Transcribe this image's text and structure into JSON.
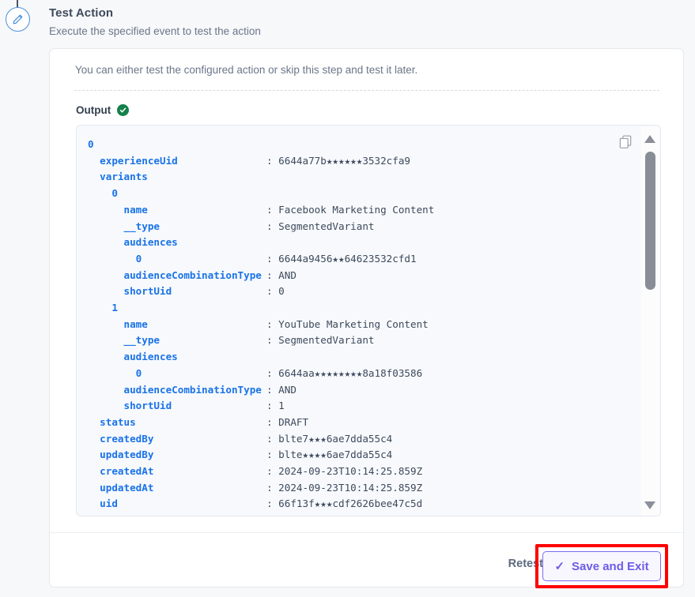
{
  "header": {
    "title": "Test Action",
    "subtitle": "Execute the specified event to test the action",
    "step_icon": "pencil-icon"
  },
  "card": {
    "intro": "You can either test the configured action or skip this step and test it later.",
    "output_label": "Output",
    "output_status_icon": "green-check-circle-icon",
    "copy_icon": "copy-icon"
  },
  "json_output": {
    "rows": [
      {
        "indent": 0,
        "key": "0",
        "colon": "",
        "value": ""
      },
      {
        "indent": 1,
        "key": "experienceUid",
        "colon": ":",
        "value": "6644a77b★★★★★★3532cfa9"
      },
      {
        "indent": 1,
        "key": "variants",
        "colon": "",
        "value": ""
      },
      {
        "indent": 2,
        "key": "0",
        "colon": "",
        "value": ""
      },
      {
        "indent": 3,
        "key": "name",
        "colon": ":",
        "value": "Facebook Marketing Content"
      },
      {
        "indent": 3,
        "key": "__type",
        "colon": ":",
        "value": "SegmentedVariant"
      },
      {
        "indent": 3,
        "key": "audiences",
        "colon": "",
        "value": ""
      },
      {
        "indent": 4,
        "key": "0",
        "colon": ":",
        "value": "6644a9456★★64623532cfd1"
      },
      {
        "indent": 3,
        "key": "audienceCombinationType",
        "colon": ":",
        "value": "AND"
      },
      {
        "indent": 3,
        "key": "shortUid",
        "colon": ":",
        "value": "0"
      },
      {
        "indent": 2,
        "key": "1",
        "colon": "",
        "value": ""
      },
      {
        "indent": 3,
        "key": "name",
        "colon": ":",
        "value": "YouTube Marketing Content"
      },
      {
        "indent": 3,
        "key": "__type",
        "colon": ":",
        "value": "SegmentedVariant"
      },
      {
        "indent": 3,
        "key": "audiences",
        "colon": "",
        "value": ""
      },
      {
        "indent": 4,
        "key": "0",
        "colon": ":",
        "value": "6644aa★★★★★★★★8a18f03586"
      },
      {
        "indent": 3,
        "key": "audienceCombinationType",
        "colon": ":",
        "value": "AND"
      },
      {
        "indent": 3,
        "key": "shortUid",
        "colon": ":",
        "value": "1"
      },
      {
        "indent": 1,
        "key": "status",
        "colon": ":",
        "value": "DRAFT"
      },
      {
        "indent": 1,
        "key": "createdBy",
        "colon": ":",
        "value": "blte7★★★6ae7dda55c4"
      },
      {
        "indent": 1,
        "key": "updatedBy",
        "colon": ":",
        "value": "blte★★★★6ae7dda55c4"
      },
      {
        "indent": 1,
        "key": "createdAt",
        "colon": ":",
        "value": "2024-09-23T10:14:25.859Z"
      },
      {
        "indent": 1,
        "key": "updatedAt",
        "colon": ":",
        "value": "2024-09-23T10:14:25.859Z"
      },
      {
        "indent": 1,
        "key": "uid",
        "colon": ":",
        "value": "66f13f★★★cdf2626bee47c5d"
      }
    ]
  },
  "scrollbar": {
    "up_arrow_icon": "triangle-up-icon",
    "down_arrow_icon": "triangle-down-icon"
  },
  "footer": {
    "retest_label": "Retest",
    "save_label": "Save and Exit",
    "save_check_glyph": "✓"
  },
  "colors": {
    "page_background": "#f7f8fa",
    "card_background": "#ffffff",
    "json_background": "#f7f9fc",
    "json_key": "#1a73e8",
    "json_value": "#3d4a5c",
    "accent_purple": "#6c5ce7",
    "highlight_red": "#ff0000",
    "status_green": "#14804a",
    "badge_blue": "#4a90d9"
  }
}
